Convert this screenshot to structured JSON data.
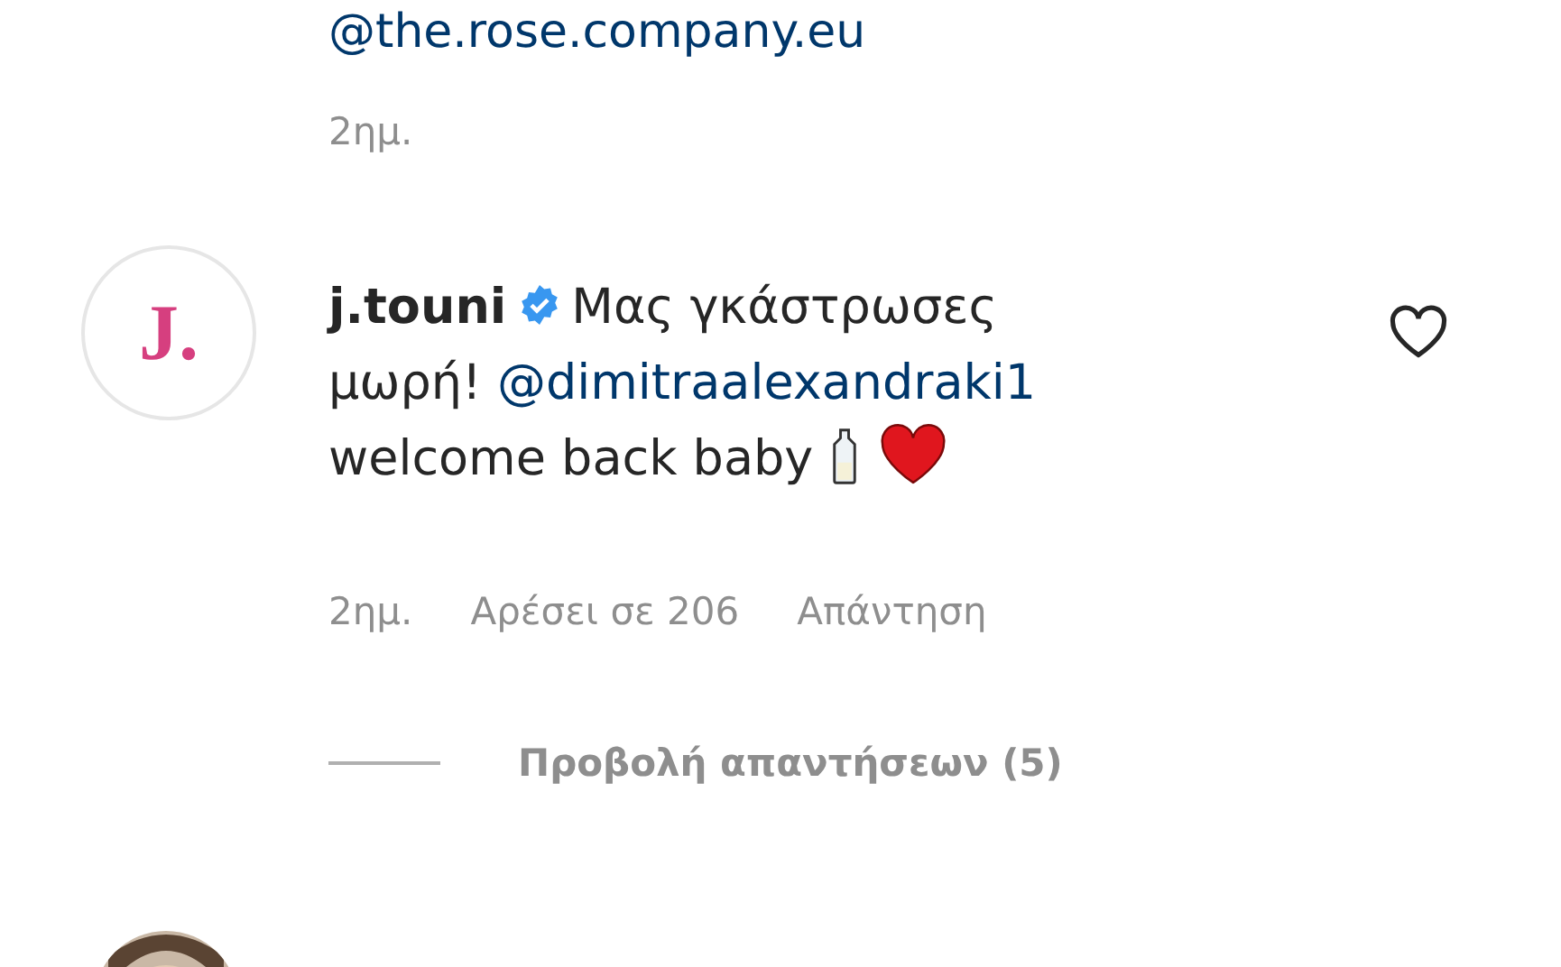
{
  "previous_comment": {
    "mention": "@the.rose.company.eu",
    "time": "2ημ."
  },
  "comment": {
    "avatar_letter": "J.",
    "username": "j.touni",
    "verified": true,
    "text": "Μας γκάστρωσες μωρή!",
    "mention": "@dimitraalexandraki1",
    "text_after": "welcome back baby",
    "liked": false,
    "time": "2ημ.",
    "likes": "Αρέσει σε 206",
    "reply": "Απάντηση",
    "view_replies": "Προβολή απαντήσεων (5)"
  }
}
